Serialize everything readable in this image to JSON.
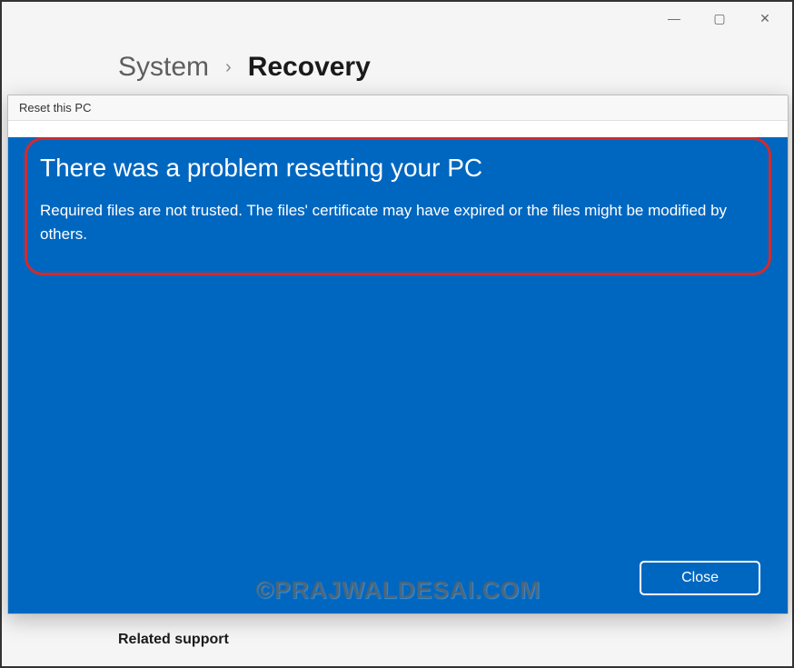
{
  "window": {
    "minimize": "—",
    "maximize": "▢",
    "close": "✕"
  },
  "breadcrumb": {
    "parent": "System",
    "separator": "›",
    "current": "Recovery"
  },
  "dialog": {
    "title": "Reset this PC",
    "heading": "There was a problem resetting your PC",
    "message": "Required files are not trusted. The files' certificate may have expired or the files might be modified by others.",
    "close_label": "Close"
  },
  "watermark": "©PRAJWALDESAI.COM",
  "section": {
    "related_support": "Related support"
  }
}
